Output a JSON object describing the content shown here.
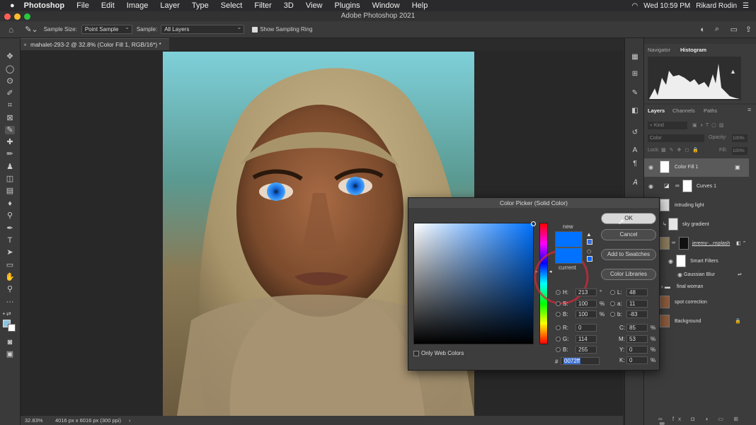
{
  "menubar": {
    "apple": "",
    "items": [
      "Photoshop",
      "File",
      "Edit",
      "Image",
      "Layer",
      "Type",
      "Select",
      "Filter",
      "3D",
      "View",
      "Plugins",
      "Window",
      "Help"
    ],
    "clock": "Wed 10:59 PM",
    "user": "Rikard Rodin"
  },
  "window": {
    "title": "Adobe Photoshop 2021"
  },
  "options": {
    "sample_size_label": "Sample Size:",
    "sample_size_value": "Point Sample",
    "sample_label": "Sample:",
    "sample_value": "All Layers",
    "sampling_ring_label": "Show Sampling Ring"
  },
  "document_tab": {
    "title": "mahalet-293-2 @ 32.8% (Color Fill 1, RGB/16*) *"
  },
  "status": {
    "zoom": "32.83%",
    "doc_info": "4016 px x 6016 px (300 ppi)"
  },
  "panels": {
    "top_tabs": [
      "Navigator",
      "Histogram"
    ],
    "layer_tabs": [
      "Layers",
      "Channels",
      "Paths"
    ],
    "kind_placeholder": "Kind",
    "blend_mode": "Color",
    "opacity_label": "Opacity:",
    "opacity_value": "100%",
    "lock_label": "Lock:",
    "fill_label": "Fill:",
    "fill_value": "100%",
    "layers": [
      {
        "name": "Color Fill 1"
      },
      {
        "name": "Curves 1"
      },
      {
        "name": "intruding light"
      },
      {
        "name": "sky gradient"
      },
      {
        "name": "jeremy-...nsplash"
      },
      {
        "name": "Smart Filters"
      },
      {
        "name": "Gaussian Blur"
      },
      {
        "name": "final woman"
      },
      {
        "name": "spot correction"
      },
      {
        "name": "Background"
      }
    ]
  },
  "color_picker": {
    "title": "Color Picker (Solid Color)",
    "ok": "OK",
    "cancel": "Cancel",
    "add_swatches": "Add to Swatches",
    "color_libraries": "Color Libraries",
    "new_label": "new",
    "current_label": "current",
    "new_color": "#0072ff",
    "current_color": "#0072ff",
    "only_web_colors": "Only Web Colors",
    "hsb": {
      "h": "213",
      "s": "100",
      "b": "100"
    },
    "h_unit": "°",
    "pct": "%",
    "rgb": {
      "r": "0",
      "g": "114",
      "b": "255"
    },
    "lab": {
      "l": "48",
      "a": "11",
      "b": "-83"
    },
    "cmyk": {
      "c": "85",
      "m": "53",
      "y": "0",
      "k": "0"
    },
    "hex_label": "#",
    "hex": "0072ff",
    "labels": {
      "H": "H:",
      "S": "S:",
      "B": "B:",
      "R": "R:",
      "G": "G:",
      "Bb": "B:",
      "L": "L:",
      "a": "a:",
      "b": "b:",
      "C": "C:",
      "M": "M:",
      "Y": "Y:",
      "K": "K:"
    }
  }
}
